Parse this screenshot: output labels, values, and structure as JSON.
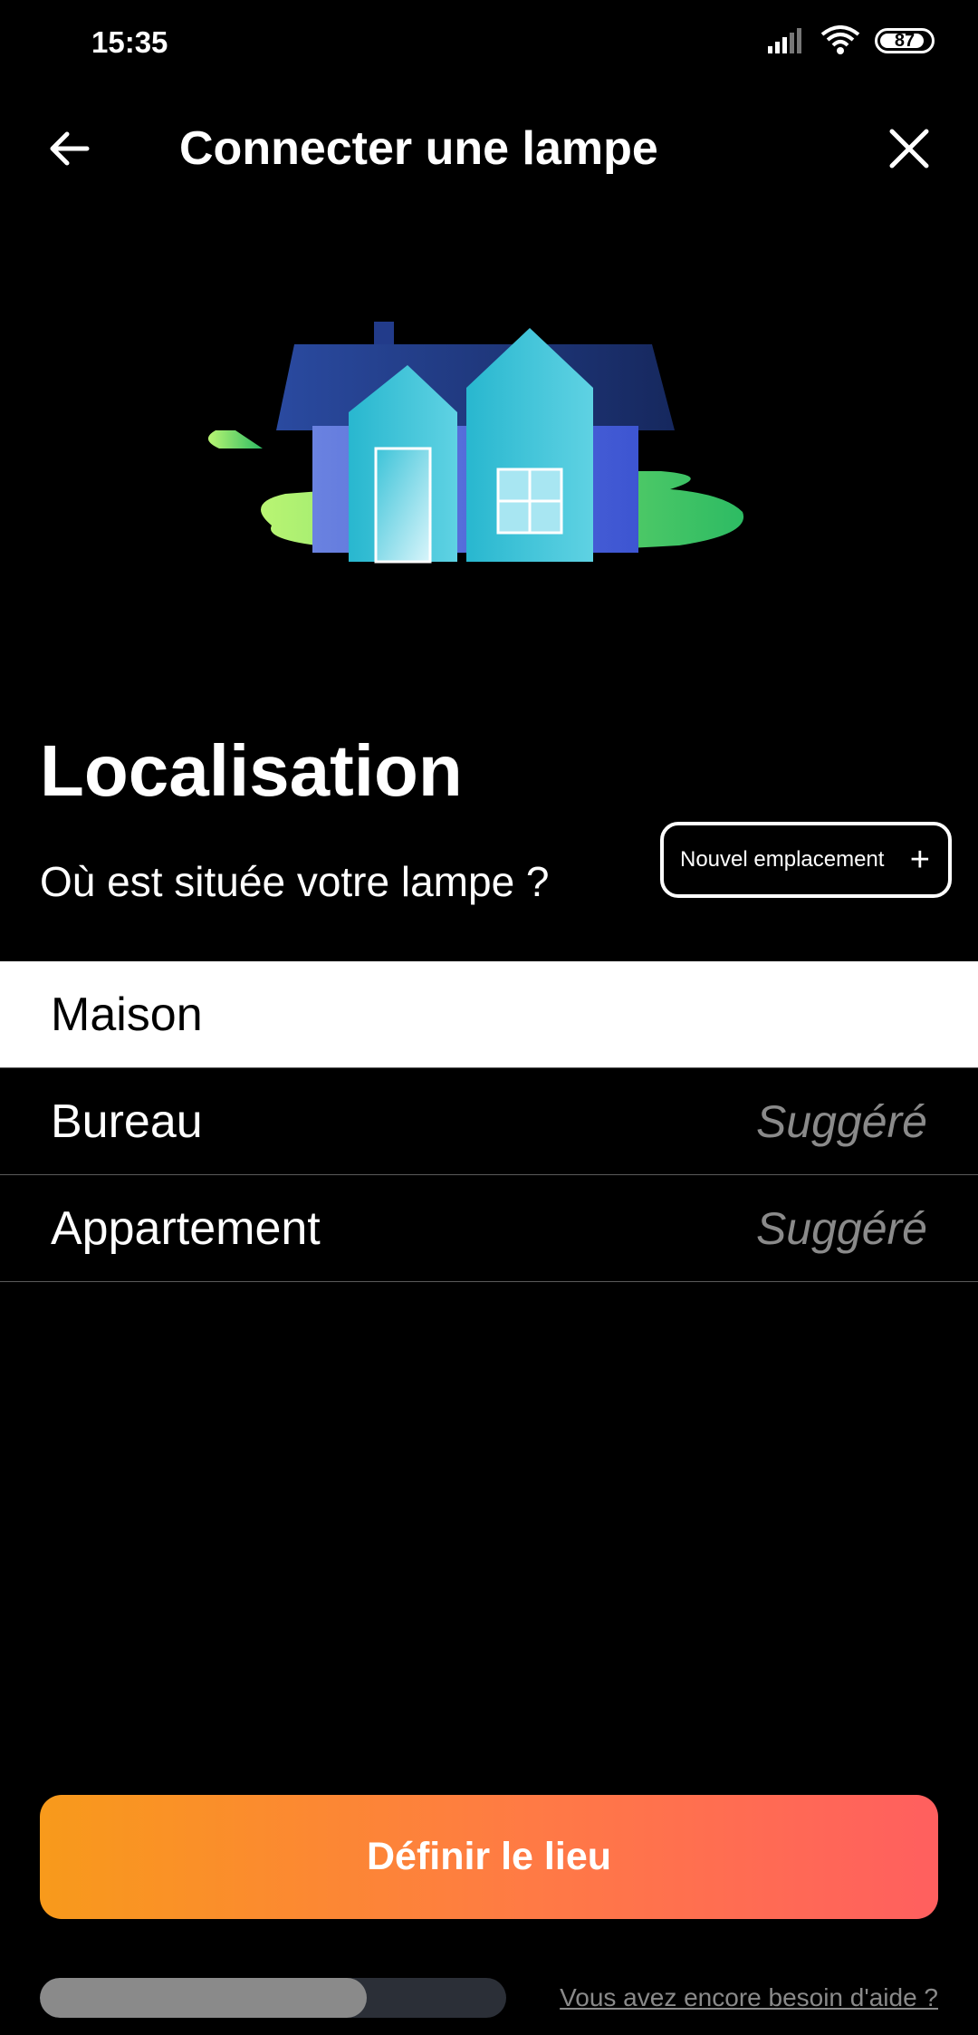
{
  "status_bar": {
    "time": "15:35",
    "battery": "87"
  },
  "header": {
    "title": "Connecter une lampe"
  },
  "section": {
    "title": "Localisation",
    "subtitle": "Où est située votre lampe ?",
    "new_location_label": "Nouvel emplacement",
    "new_location_icon": "+"
  },
  "locations": [
    {
      "name": "Maison",
      "tag": "",
      "selected": true
    },
    {
      "name": "Bureau",
      "tag": "Suggéré",
      "selected": false
    },
    {
      "name": "Appartement",
      "tag": "Suggéré",
      "selected": false
    }
  ],
  "primary_action": {
    "label": "Définir le lieu"
  },
  "progress": {
    "fraction": 0.7
  },
  "help_link": {
    "label": "Vous avez encore besoin d'aide ?"
  },
  "colors": {
    "accent_start": "#f89a1b",
    "accent_end": "#ff5f5f",
    "muted": "#8a8a8a"
  }
}
